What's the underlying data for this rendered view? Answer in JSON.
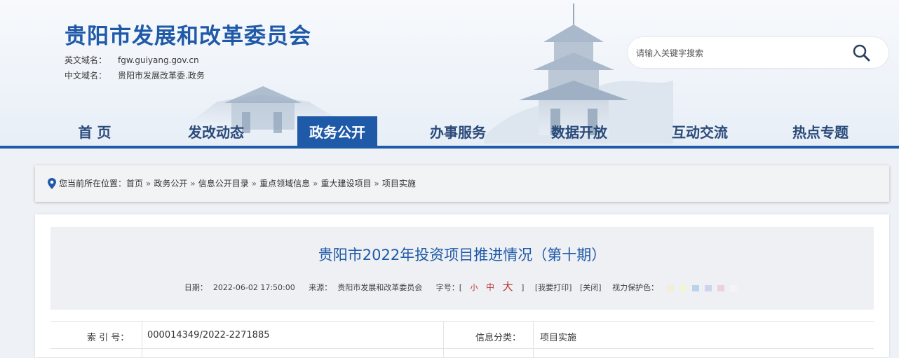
{
  "header": {
    "site_title": "贵阳市发展和改革委员会",
    "en_domain_label": "英文域名：",
    "en_domain_value": "fgw.guiyang.gov.cn",
    "cn_domain_label": "中文域名：",
    "cn_domain_value": "贵阳市发展改革委.政务",
    "search_placeholder": "请输入关键字搜索"
  },
  "nav": {
    "items": [
      {
        "label": "首 页"
      },
      {
        "label": "发改动态"
      },
      {
        "label": "政务公开"
      },
      {
        "label": "办事服务"
      },
      {
        "label": "数据开放"
      },
      {
        "label": "互动交流"
      },
      {
        "label": "热点专题"
      }
    ],
    "active_color": "#1f5aa8"
  },
  "breadcrumb": {
    "prefix": "您当前所在位置：",
    "items": [
      "首页",
      "政务公开",
      "信息公开目录",
      "重点领域信息",
      "重大建设项目",
      "项目实施"
    ],
    "separator": "»"
  },
  "article": {
    "title": "贵阳市2022年投资项目推进情况（第十期）",
    "date_label": "日期：",
    "date": "2022-06-02 17:50:00",
    "source_label": "来源：",
    "source": "贵阳市发展和改革委员会",
    "font_label": "字号：[",
    "font_small": "小",
    "font_medium": "中",
    "font_large": "大",
    "font_close": "]",
    "print": "[我要打印]",
    "close": "[关闭]",
    "eye_care": "视力保护色：",
    "eye_colors": [
      "#f2eed8",
      "#eef5d8",
      "#b9d3ec",
      "#cfd3ef",
      "#ecd0de",
      "#f4f4f4"
    ]
  },
  "info": {
    "index_label": "索 引 号：",
    "index_value": "000014349/2022-2271885",
    "category_label": "信息分类：",
    "category_value": "项目实施"
  }
}
